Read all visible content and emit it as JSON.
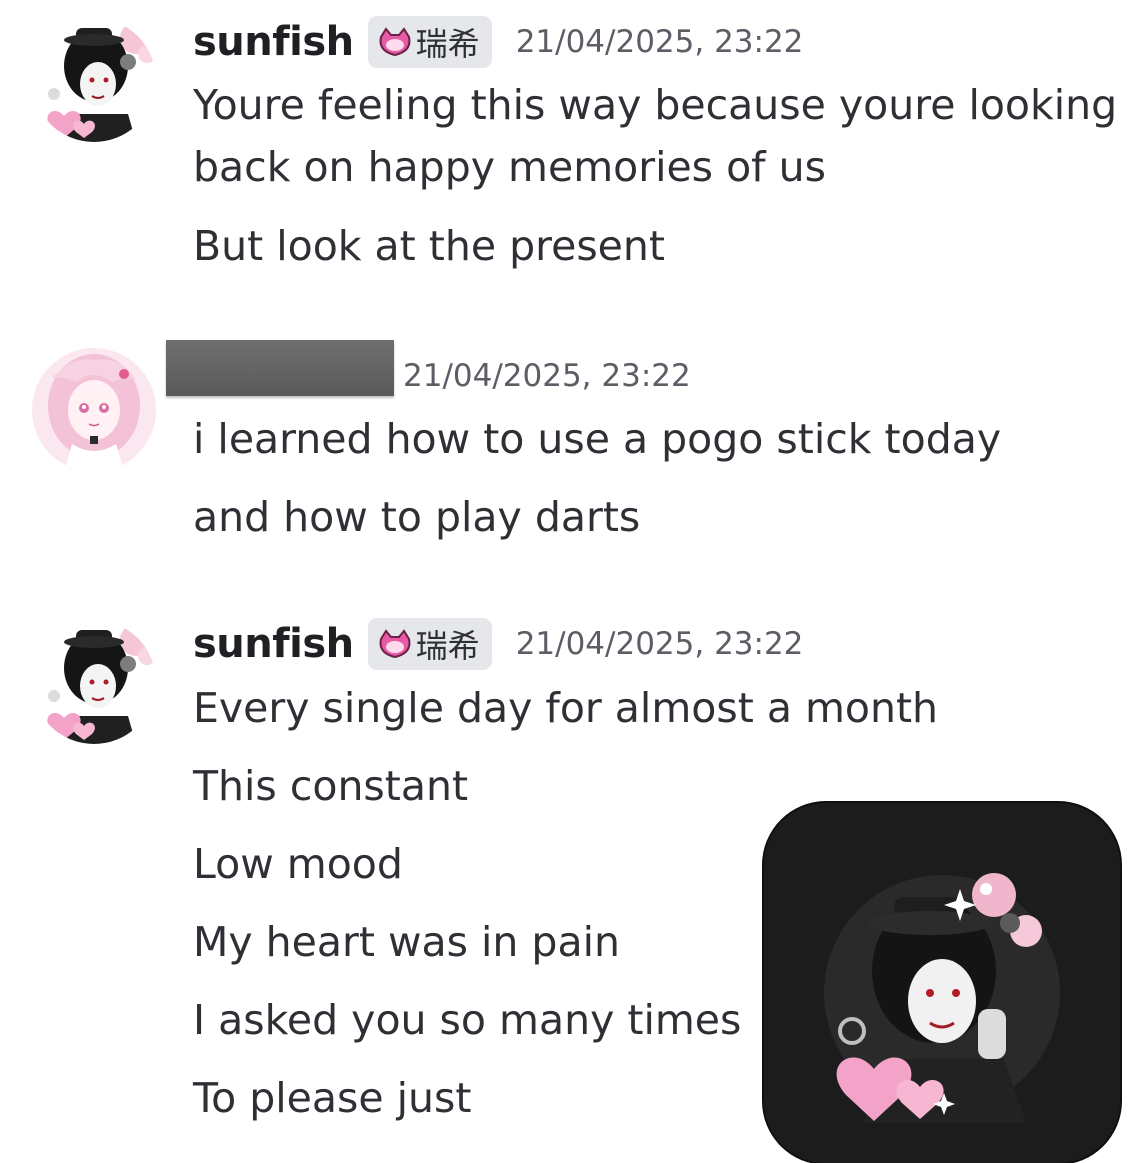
{
  "messages": [
    {
      "author": "sunfish",
      "tag": "瑞希",
      "timestamp": "21/04/2025, 23:22",
      "lines": [
        "Youre feeling this way because youre looking",
        "back on happy memories of us",
        "But look at the present"
      ]
    },
    {
      "author": "",
      "author_redacted": true,
      "timestamp": "21/04/2025, 23:22",
      "lines": [
        "i learned how to use a pogo stick today",
        "and how to play darts"
      ]
    },
    {
      "author": "sunfish",
      "tag": "瑞希",
      "timestamp": "21/04/2025, 23:22",
      "lines": [
        "Every single day for almost a month",
        "This constant",
        "Low mood",
        "My heart was in pain",
        "I asked you so many times",
        "To please just"
      ]
    }
  ],
  "icons": {
    "tag_icon": "pink-cat-icon",
    "avatar_sunfish": "avatar-dark-hair-pink-hearts",
    "avatar_other": "avatar-pink-hair-anime",
    "popup_image": "enlarged-avatar-dark-hair-pink-hearts"
  },
  "colors": {
    "background": "#ffffff",
    "text": "#2e3035",
    "timestamp": "#5c5e66",
    "tag_bg": "#e6e7ea",
    "popup_bg": "#1c1c1d",
    "heart_pink": "#f4a3c8"
  }
}
